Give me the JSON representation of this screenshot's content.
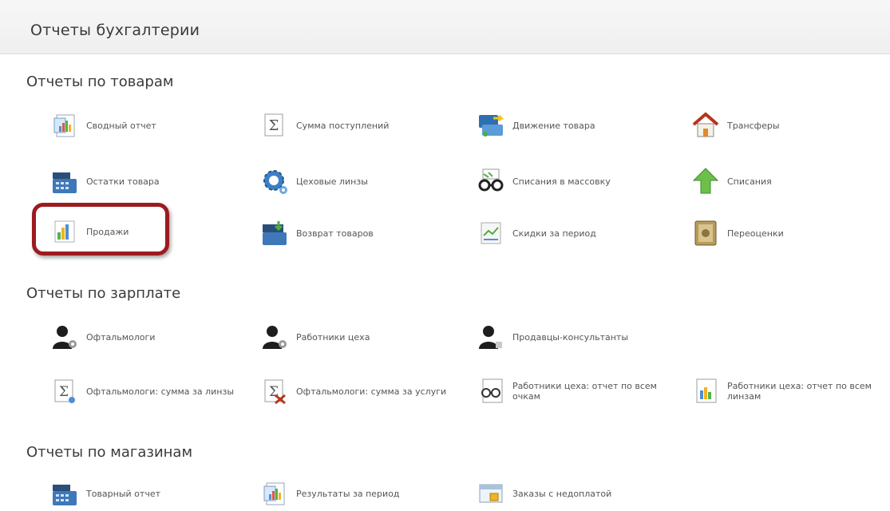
{
  "header": {
    "title": "Отчеты бухгалтерии"
  },
  "sections": {
    "goods": {
      "title": "Отчеты по товарам",
      "items": [
        {
          "label": "Сводный отчет",
          "icon": "report-chart-icon"
        },
        {
          "label": "Сумма поступлений",
          "icon": "sigma-icon"
        },
        {
          "label": "Движение товара",
          "icon": "goods-movement-icon"
        },
        {
          "label": "Трансферы",
          "icon": "house-icon"
        },
        {
          "label": "Остатки товара",
          "icon": "cash-register-icon"
        },
        {
          "label": "Цеховые линзы",
          "icon": "gear-icon"
        },
        {
          "label": "Списания в массовку",
          "icon": "glasses-icon"
        },
        {
          "label": "Списания",
          "icon": "green-arrow-up-icon"
        },
        {
          "label": "Продажи",
          "icon": "sales-chart-icon"
        },
        {
          "label": "Возврат товаров",
          "icon": "return-goods-icon"
        },
        {
          "label": "Скидки за период",
          "icon": "discount-icon"
        },
        {
          "label": "Переоценки",
          "icon": "revaluation-icon"
        }
      ]
    },
    "salary": {
      "title": "Отчеты по зарплате",
      "items": [
        {
          "label": "Офтальмологи",
          "icon": "user-gear-icon"
        },
        {
          "label": "Работники цеха",
          "icon": "user-gear-icon"
        },
        {
          "label": "Продавцы-консультанты",
          "icon": "user-icon"
        },
        {
          "label": "Офтальмологи: сумма за линзы",
          "icon": "sigma-doc-icon"
        },
        {
          "label": "Офтальмологи: сумма за услуги",
          "icon": "sigma-tools-icon"
        },
        {
          "label": "Работники цеха: отчет по всем очкам",
          "icon": "glasses-doc-icon"
        },
        {
          "label": "Работники цеха: отчет по всем линзам",
          "icon": "lens-doc-icon"
        }
      ]
    },
    "stores": {
      "title": "Отчеты по магазинам",
      "items": [
        {
          "label": "Товарный отчет",
          "icon": "cash-register-icon"
        },
        {
          "label": "Результаты за период",
          "icon": "report-chart-icon"
        },
        {
          "label": "Заказы с недоплатой",
          "icon": "underpaid-orders-icon"
        }
      ]
    }
  },
  "colors": {
    "highlight_border": "#9c1b1f",
    "header_bg": "#f2f2f2"
  }
}
